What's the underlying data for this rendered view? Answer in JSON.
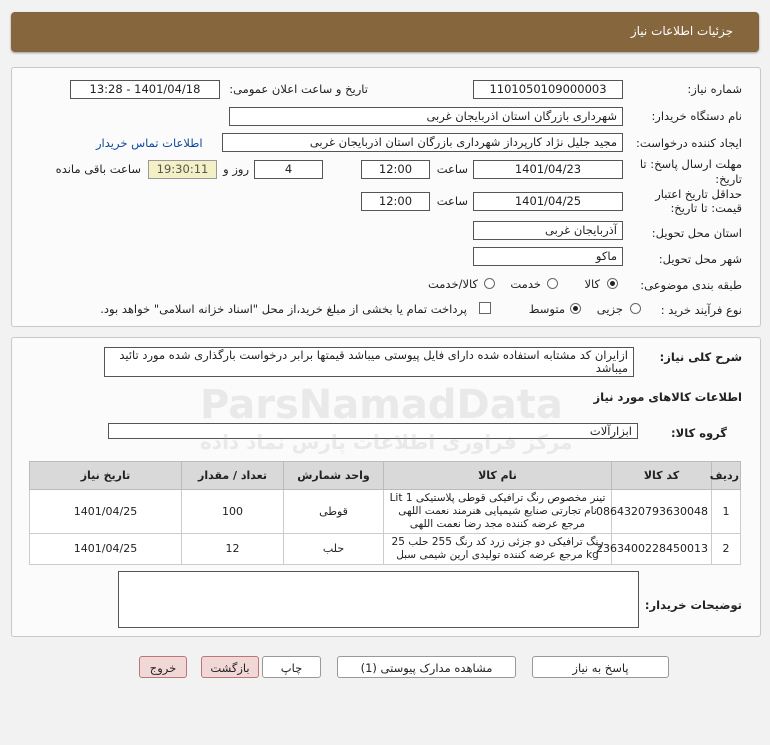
{
  "title": "جزئیات اطلاعات نیاز",
  "need": {
    "number_label": "شماره نیاز:",
    "number": "1101050109000003",
    "announce_label": "تاریخ و ساعت اعلان عمومی:",
    "announce": "1401/04/18 - 13:28",
    "buyer_label": "نام دستگاه خریدار:",
    "buyer": "شهرداری بازرگان استان اذربایجان غربی",
    "creator_label": "ایجاد کننده درخواست:",
    "creator": "مجید جلیل نژاد کارپرداز شهرداری بازرگان استان اذربایجان غربی",
    "contact_link": "اطلاعات تماس خریدار",
    "deadline_label_1": "مهلت ارسال پاسخ: تا",
    "deadline_label_2": "تاریخ:",
    "deadline_date": "1401/04/23",
    "time_label": "ساعت",
    "deadline_time": "12:00",
    "days": "4",
    "days_label": "روز و",
    "remaining": "19:30:11",
    "remaining_label": "ساعت باقی مانده",
    "validity_label_1": "حداقل تاریخ اعتبار",
    "validity_label_2": "قیمت: تا تاریخ:",
    "validity_date": "1401/04/25",
    "validity_time": "12:00",
    "province_label": "استان محل تحویل:",
    "province": "آذربایجان غربی",
    "city_label": "شهر محل تحویل:",
    "city": "ماکو",
    "category_label": "طبقه بندی موضوعی:",
    "cat_goods": "کالا",
    "cat_service": "خدمت",
    "cat_both": "کالا/خدمت",
    "process_label": "نوع فرآیند خرید :",
    "proc_partial": "جزیی",
    "proc_medium": "متوسط",
    "payment_note": "پرداخت تمام یا بخشی از مبلغ خرید،از محل \"اسناد خزانه اسلامی\" خواهد بود."
  },
  "description": {
    "label": "شرح کلی نیاز:",
    "text": "ازایران کد مشتابه استفاده شده دارای فایل پیوستی میباشد قیمتها برابر درخواست بارگذاری شده مورد تائید میباشد"
  },
  "goods": {
    "section_title": "اطلاعات کالاهای مورد نیاز",
    "group_label": "گروه کالا:",
    "group": "ابزارآلات",
    "headers": [
      "ردیف",
      "کد کالا",
      "نام کالا",
      "واحد شمارش",
      "تعداد / مقدار",
      "تاریخ نیاز"
    ],
    "rows": [
      {
        "idx": "1",
        "code": "0864320793630048",
        "name": "تینر مخصوص رنگ ترافیکی قوطی پلاستیکی 1 Lit نام تجارتی صنایع شیمیایی هنرمند نعمت اللهی مرجع عرضه کننده مجد رضا نعمت اللهی",
        "unit": "قوطی",
        "qty": "100",
        "date": "1401/04/25"
      },
      {
        "idx": "2",
        "code": "2363400228450013",
        "name": "رنگ ترافیکی دو جزئی زرد کد رنگ 255 حلب 25 kg مرجع عرضه کننده تولیدی ارین شیمی سبل",
        "unit": "حلب",
        "qty": "12",
        "date": "1401/04/25"
      }
    ]
  },
  "notes_label": "توضیحات خریدار:",
  "buttons": {
    "reply": "پاسخ به نیاز",
    "attachments": "مشاهده مدارک پیوستی (1)",
    "print": "چاپ",
    "back": "بازگشت",
    "exit": "خروج"
  },
  "watermark": {
    "line1": "ParsNamadData",
    "line2": "مرکز فراوری اطلاعات پارس نماد داده"
  },
  "colors": {
    "titlebar": "#86663c",
    "link": "#0b4aa0",
    "remaining_bg": "#f2f0c4",
    "danger_button_bg": "#f2d7d7"
  }
}
